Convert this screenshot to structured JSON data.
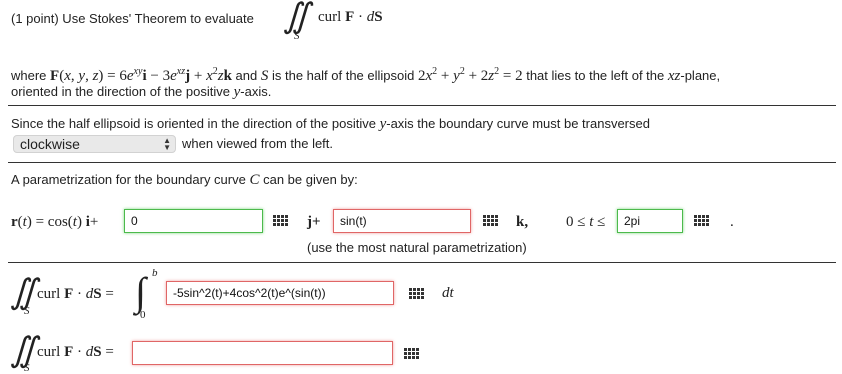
{
  "problem": {
    "points": "(1 point) Use Stokes' Theorem to evaluate",
    "integrand": "curl F · dS",
    "surface_sub": "S",
    "where_pre": "where",
    "where_F": "F(x, y, z) = 6e^{xy} i − 3e^{xz} j + x²z k",
    "where_mid": "and",
    "S_sym": "S",
    "where_post": "is the half of the ellipsoid",
    "ellipsoid": "2x² + y² + 2z² = 2",
    "where_tail": "that lies to the left of the xz-plane,",
    "orientation": "oriented in the direction of the positive y-axis."
  },
  "part1": {
    "sentence": "Since the half ellipsoid is oriented in the direction of the positive y-axis the boundary curve must be transversed",
    "select_value": "clockwise",
    "after_select": "when viewed from the left."
  },
  "part2": {
    "sentence": "A parametrization for the boundary curve C can be given by:",
    "r_lhs": "r(t) = cos(t) i+",
    "i_component": "0",
    "j_label": "j+",
    "j_component": "sin(t)",
    "k_label": "k,",
    "range_label": "0 ≤ t ≤",
    "upper_limit": "2pi",
    "period": ".",
    "note": "(use the most natural parametrization)"
  },
  "part3": {
    "integral_lhs": "curl F · dS =",
    "lower": "0",
    "upper": "b",
    "integrand_value": "-5sin^2(t)+4cos^2(t)e^(sin(t))",
    "dt": "dt"
  },
  "part4": {
    "integral_lhs": "curl F · dS =",
    "answer": ""
  },
  "colors": {
    "correct": "#4cba4c",
    "incorrect": "#e06666",
    "rule": "#333333"
  },
  "icons": [
    "keypad-icon",
    "select-arrows-icon"
  ]
}
